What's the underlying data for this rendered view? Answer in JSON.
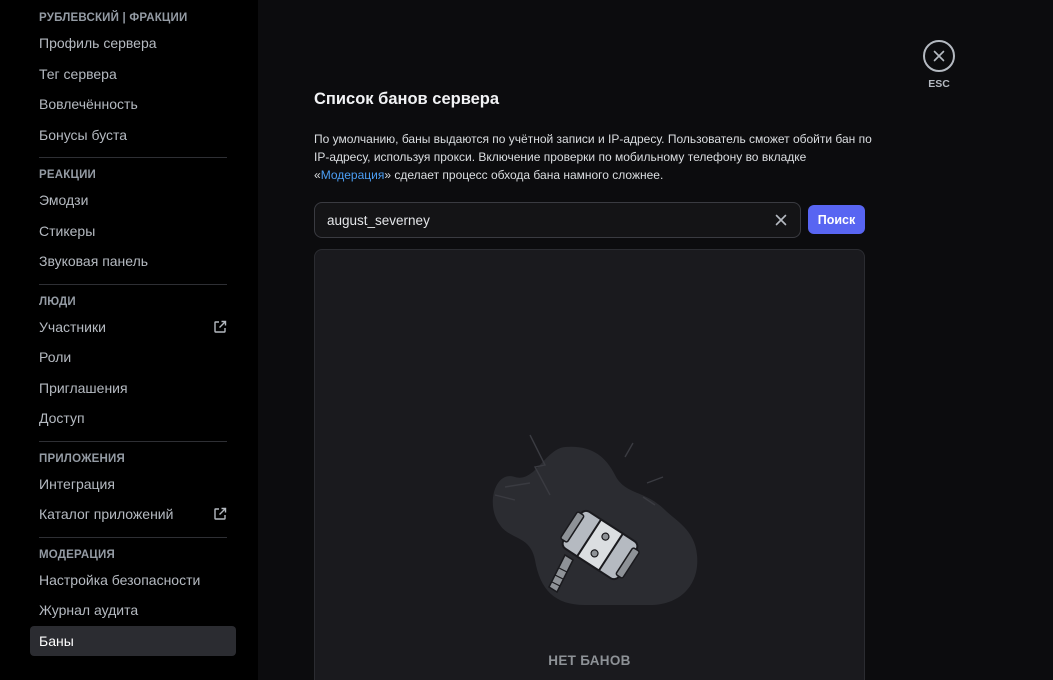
{
  "sidebar": {
    "sections": [
      {
        "header": "РУБЛЕВСКИЙ | ФРАКЦИИ",
        "items": [
          {
            "label": "Профиль сервера"
          },
          {
            "label": "Тег сервера"
          },
          {
            "label": "Вовлечённость"
          },
          {
            "label": "Бонусы буста"
          }
        ]
      },
      {
        "header": "РЕАКЦИИ",
        "items": [
          {
            "label": "Эмодзи"
          },
          {
            "label": "Стикеры"
          },
          {
            "label": "Звуковая панель"
          }
        ]
      },
      {
        "header": "ЛЮДИ",
        "items": [
          {
            "label": "Участники",
            "icon": "external-link-icon"
          },
          {
            "label": "Роли"
          },
          {
            "label": "Приглашения"
          },
          {
            "label": "Доступ"
          }
        ]
      },
      {
        "header": "ПРИЛОЖЕНИЯ",
        "items": [
          {
            "label": "Интеграция"
          },
          {
            "label": "Каталог приложений",
            "icon": "external-link-icon"
          }
        ]
      },
      {
        "header": "МОДЕРАЦИЯ",
        "items": [
          {
            "label": "Настройка безопасности"
          },
          {
            "label": "Журнал аудита"
          },
          {
            "label": "Баны",
            "selected": true
          }
        ]
      }
    ]
  },
  "main": {
    "title": "Список банов сервера",
    "description_before": "По умолчанию, баны выдаются по учётной записи и IP-адресу. Пользователь сможет обойти бан по IP-адресу, используя прокси. Включение проверки по мобильному телефону во вкладке «",
    "description_link": "Модерация",
    "description_after": "» сделает процесс обхода бана намного сложнее.",
    "search": {
      "value": "august_severney",
      "button_label": "Поиск"
    },
    "empty_state": {
      "text": "НЕТ БАНОВ",
      "icon": "ban-hammer-icon"
    },
    "close": {
      "label": "ESC",
      "icon": "close-icon"
    }
  },
  "colors": {
    "accent": "#5865f2",
    "link": "#4b9ef4",
    "selected_bg": "#2b2c31"
  }
}
